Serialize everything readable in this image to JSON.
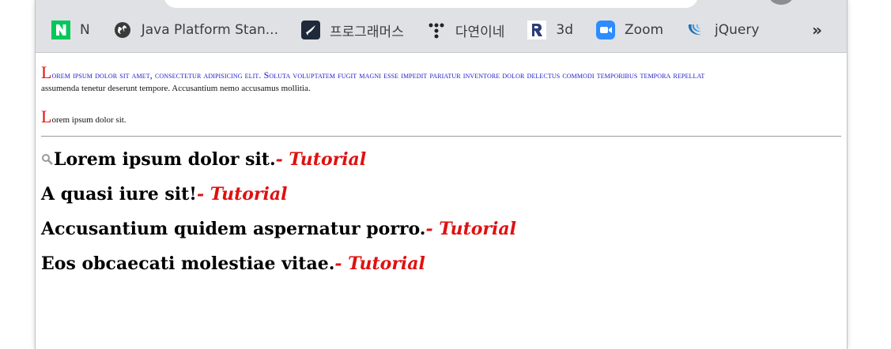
{
  "browser": {
    "bookmarks": [
      {
        "label": "N",
        "icon": "naver-icon"
      },
      {
        "label": "Java Platform Stan...",
        "icon": "globe-icon"
      },
      {
        "label": "프로그래머스",
        "icon": "programmers-icon"
      },
      {
        "label": "다연이네",
        "icon": "dots-icon"
      },
      {
        "label": "3d",
        "icon": "r-logo-icon"
      },
      {
        "label": "Zoom",
        "icon": "zoom-icon"
      },
      {
        "label": "jQuery",
        "icon": "jquery-icon"
      }
    ],
    "more_label": "»"
  },
  "page": {
    "para1": {
      "initial": "L",
      "smallcaps": "orem ipsum dolor sit amet, consectetur adipisicing elit. Soluta voluptatem fugit magni esse impedit pariatur inventore dolor delectus commodi temporibus tempora repellat",
      "rest": "assumenda tenetur deserunt tempore. Accusantium nemo accusamus mollitia."
    },
    "para2": {
      "initial": "L",
      "rest": "orem ipsum dolor sit."
    },
    "headings": [
      {
        "text": "Lorem ipsum dolor sit.",
        "suffix": "- Tutorial"
      },
      {
        "text": "A quasi iure sit!",
        "suffix": "- Tutorial"
      },
      {
        "text": "Accusantium quidem aspernatur porro.",
        "suffix": "- Tutorial"
      },
      {
        "text": "Eos obcaecati molestiae vitae.",
        "suffix": "- Tutorial"
      }
    ]
  },
  "colors": {
    "accent": "#e01010",
    "smallcaps": "#1a1ac8"
  }
}
